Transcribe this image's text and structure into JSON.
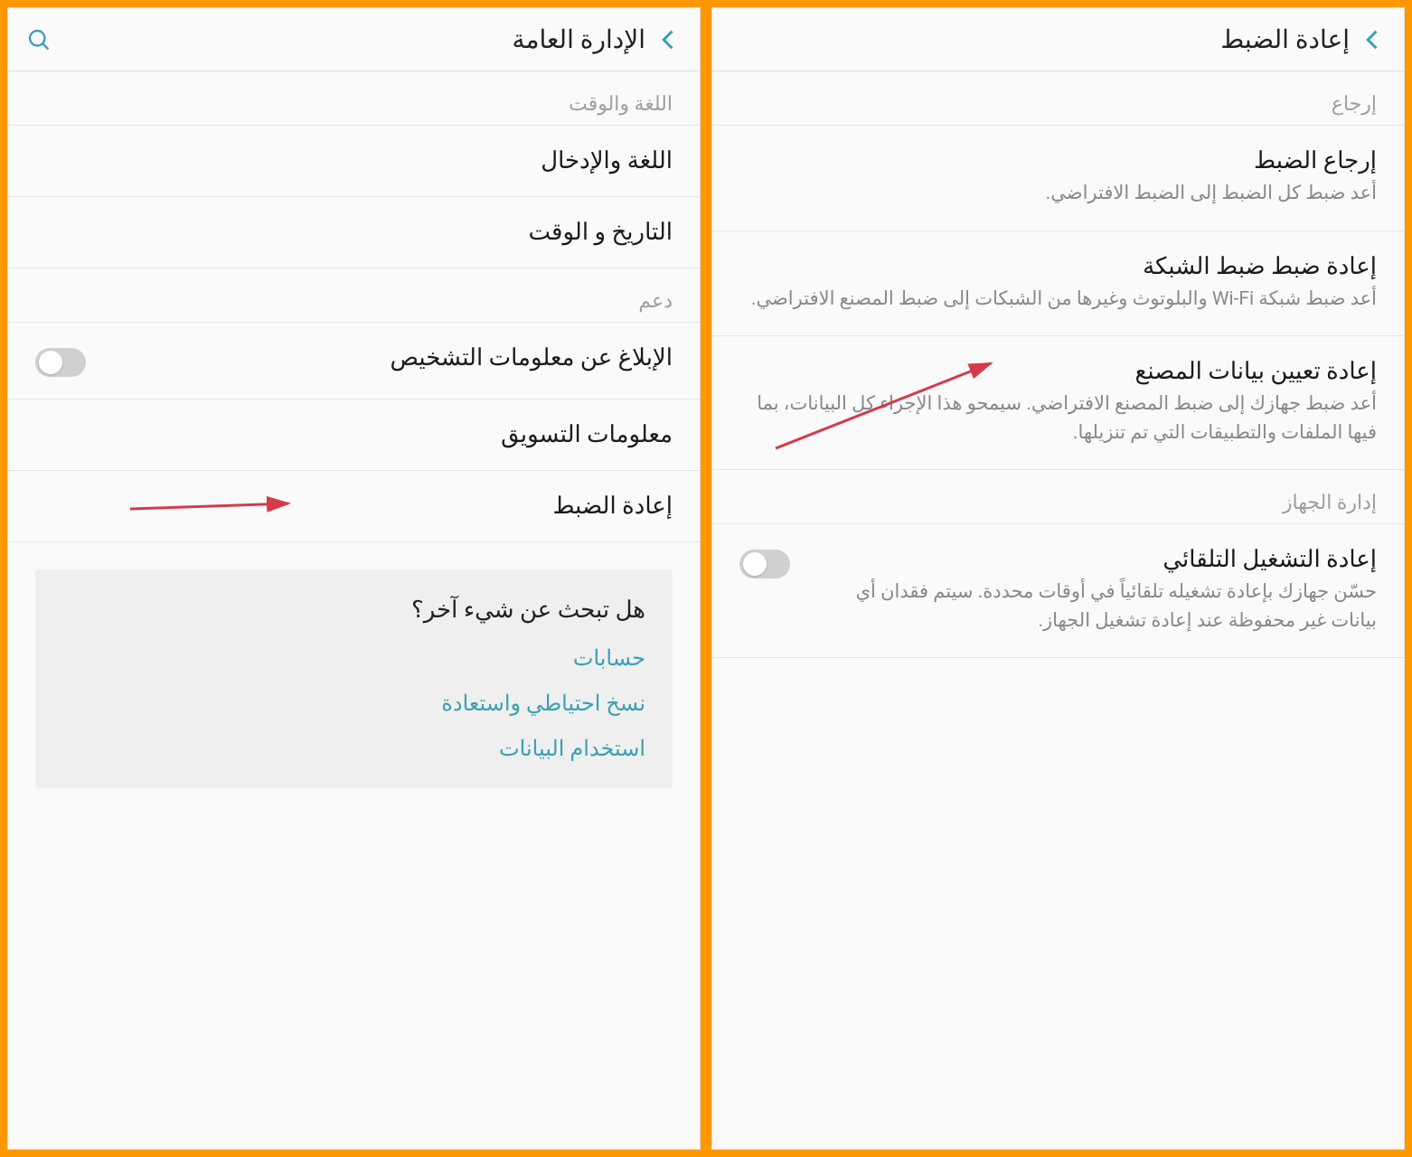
{
  "left": {
    "title": "الإدارة العامة",
    "section1": "اللغة والوقت",
    "item_language": "اللغة والإدخال",
    "item_datetime": "التاريخ و الوقت",
    "section2": "دعم",
    "item_diagnostics": "الإبلاغ عن معلومات التشخيص",
    "item_marketing": "معلومات التسويق",
    "item_reset": "إعادة الضبط",
    "suggestions_title": "هل تبحث عن شيء آخر؟",
    "suggestion_accounts": "حسابات",
    "suggestion_backup": "نسخ احتياطي واستعادة",
    "suggestion_data": "استخدام البيانات"
  },
  "right": {
    "title": "إعادة الضبط",
    "section1": "إرجاع",
    "item_reset_settings_title": "إرجاع الضبط",
    "item_reset_settings_sub": "أعد ضبط كل الضبط إلى الضبط الافتراضي.",
    "item_reset_network_title": "إعادة ضبط ضبط الشبكة",
    "item_reset_network_sub": "أعد ضبط شبكة Wi-Fi والبلوتوث وغيرها من الشبكات إلى ضبط المصنع الافتراضي.",
    "item_reset_factory_title": "إعادة تعيين بيانات المصنع",
    "item_reset_factory_sub": "أعد ضبط جهازك إلى ضبط المصنع الافتراضي. سيمحو هذا الإجراء كل البيانات، بما فيها الملفات والتطبيقات التي تم تنزيلها.",
    "section2": "إدارة الجهاز",
    "item_auto_restart_title": "إعادة التشغيل التلقائي",
    "item_auto_restart_sub": "حسّن جهازك بإعادة تشغيله تلقائياً في أوقات محددة. سيتم فقدان أي بيانات غير محفوظة عند إعادة تشغيل الجهاز."
  }
}
